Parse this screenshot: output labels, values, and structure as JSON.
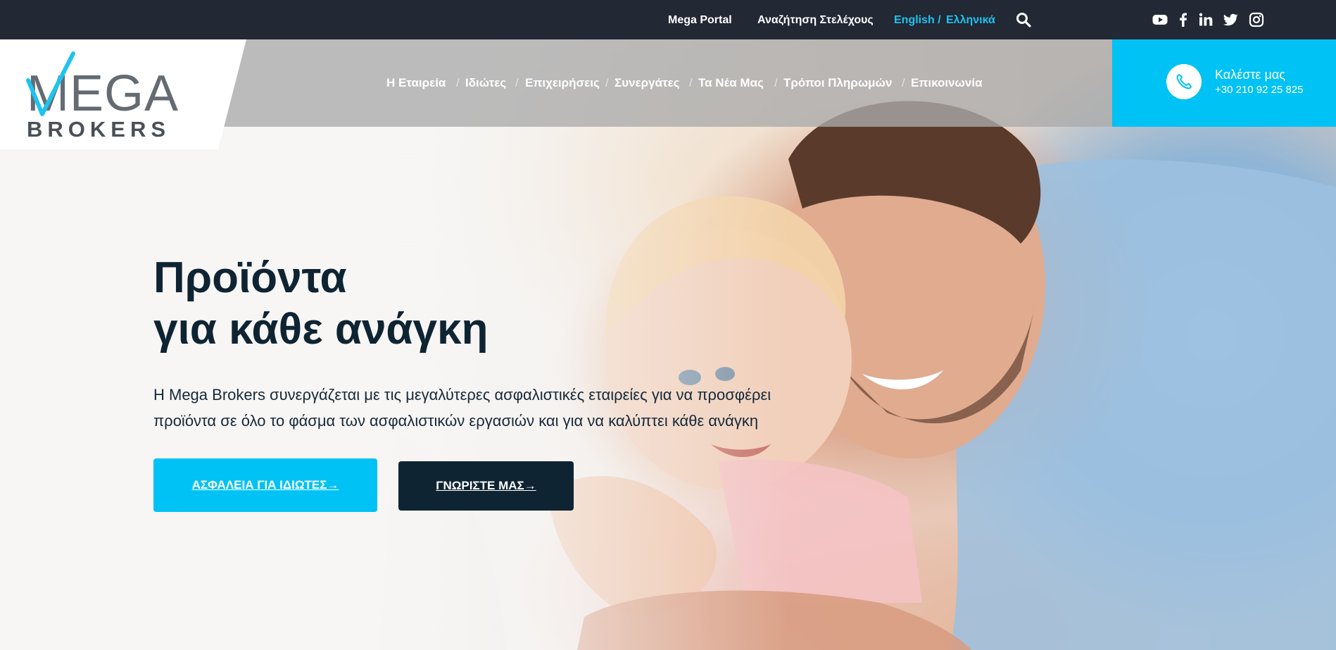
{
  "topbar": {
    "links": [
      "Mega Portal",
      "Αναζήτηση Στελέχους"
    ],
    "language_en": "English /",
    "language_el": "Ελληνικά",
    "search_icon": "search-icon",
    "social_icons": [
      "youtube-icon",
      "facebook-icon",
      "linkedin-icon",
      "twitter-icon",
      "instagram-icon"
    ]
  },
  "logo": {
    "top": "MEGA",
    "bottom": "BROKERS",
    "accent_color": "#1ec3ef"
  },
  "nav": {
    "items": [
      "Η Εταιρεία",
      "Ιδιώτες",
      "Επιχειρήσεις",
      "Συνεργάτες",
      "Τα Νέα Μας",
      "Τρόποι Πληρωμών",
      "Επικοινωνία"
    ],
    "separator": "/"
  },
  "call": {
    "label": "Καλέστε μας",
    "number": "+30 210 92 25 825",
    "icon": "phone-icon"
  },
  "hero": {
    "headline_line1": "Προϊόντα",
    "headline_line2": "για κάθε ανάγκη",
    "lead": "Η Mega Brokers συνεργάζεται με τις μεγαλύτερες ασφαλιστικές εταιρείες για να προσφέρει προϊόντα σε όλο το φάσμα των ασφαλιστικών εργασιών και για να καλύπτει κάθε ανάγκη",
    "primary_button": "ΑΣΦΑΛΕΙΑ ΓΙΑ ΙΔΙΩΤΕΣ→",
    "secondary_button": "ΓΝΩΡΙΣΤΕ ΜΑΣ→"
  },
  "colors": {
    "topbar_bg": "#222834",
    "accent": "#00c2f4",
    "dark": "#0f2433"
  }
}
